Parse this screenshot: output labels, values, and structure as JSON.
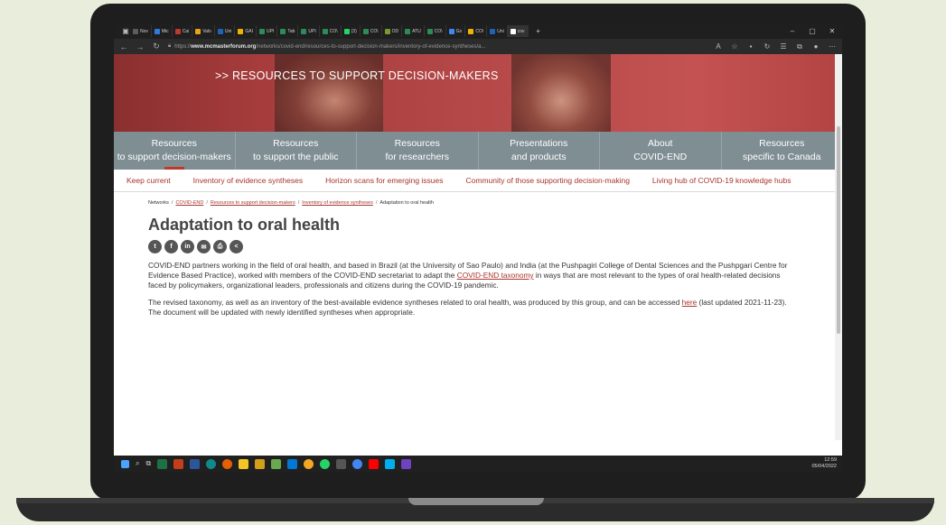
{
  "browser": {
    "tabs": [
      {
        "label": "Nov",
        "color": "#5c5c5c"
      },
      {
        "label": "Mic",
        "color": "#2d7be0"
      },
      {
        "label": "Cai",
        "color": "#c0392b"
      },
      {
        "label": "Valo",
        "color": "#e8a21a"
      },
      {
        "label": "Uni",
        "color": "#1f62b8"
      },
      {
        "label": "GAI",
        "color": "#f0b400"
      },
      {
        "label": "UPI",
        "color": "#2e8b57"
      },
      {
        "label": "Tab",
        "color": "#2e8b57"
      },
      {
        "label": "UPI",
        "color": "#2e8b57"
      },
      {
        "label": "CO\\",
        "color": "#2e8b57"
      },
      {
        "label": "(3)",
        "color": "#25d366"
      },
      {
        "label": "CO\\",
        "color": "#2e8b57"
      },
      {
        "label": "OD",
        "color": "#7a9a2e"
      },
      {
        "label": "ATU",
        "color": "#2e8b57"
      },
      {
        "label": "CO\\",
        "color": "#2e8b57"
      },
      {
        "label": "Go",
        "color": "#4285f4"
      },
      {
        "label": "CO\\",
        "color": "#f0b400"
      },
      {
        "label": "Uni",
        "color": "#1f62b8"
      },
      {
        "label": "cov",
        "color": "#ffffff"
      }
    ],
    "url_prefix": "https://",
    "url_domain": "www.mcmasterforum.org",
    "url_path": "/networks/covid-end/resources-to-support-decision-makers/inventory-of-evidence-syntheses/a..."
  },
  "hero": {
    "title": ">> RESOURCES TO SUPPORT DECISION-MAKERS"
  },
  "mainnav": [
    {
      "line1": "Resources",
      "line2": "to support decision-makers",
      "active": true
    },
    {
      "line1": "Resources",
      "line2": "to support the public",
      "active": false
    },
    {
      "line1": "Resources",
      "line2": "for researchers",
      "active": false
    },
    {
      "line1": "Presentations",
      "line2": "and products",
      "active": false
    },
    {
      "line1": "About",
      "line2": "COVID-END",
      "active": false
    },
    {
      "line1": "Resources",
      "line2": "specific to Canada",
      "active": false
    }
  ],
  "subnav": [
    "Keep current",
    "Inventory of evidence syntheses",
    "Horizon scans for emerging issues",
    "Community of those supporting decision-making",
    "Living hub of COVID-19 knowledge hubs"
  ],
  "breadcrumb": {
    "networks": "Networks",
    "covid_end": "COVID-END",
    "resources": "Resources to support decision-makers",
    "inventory": "Inventory of evidence syntheses",
    "current": "Adaptation to oral health"
  },
  "page_title": "Adaptation to oral health",
  "share_icons": [
    "twitter-icon",
    "facebook-icon",
    "linkedin-icon",
    "email-icon",
    "print-icon",
    "share-icon"
  ],
  "para1": {
    "text": "COVID-END partners working in the field of oral health, and based in Brazil (at the University of Sao Paulo) and India (at the Pushpagiri College of Dental Sciences and the Pushpgari Centre for Evidence Based Practice), worked with members of the COVID-END secretariat to adapt the ",
    "link": "COVID-END taxonomy",
    "text_after": " in ways that are most relevant to the types of oral health-related decisions faced by policymakers, organizational leaders, professionals and citizens during the COVID-19 pandemic."
  },
  "para2": {
    "text": "The revised taxonomy, as well as an inventory of the best-available evidence syntheses related to oral health, was produced by this group, and can be accessed ",
    "link": "here",
    "text_after": " (last updated 2021-11-23). The document will be updated with newly identified syntheses when appropriate."
  },
  "taskbar": {
    "time": "12:59",
    "date": "05/04/2022"
  }
}
